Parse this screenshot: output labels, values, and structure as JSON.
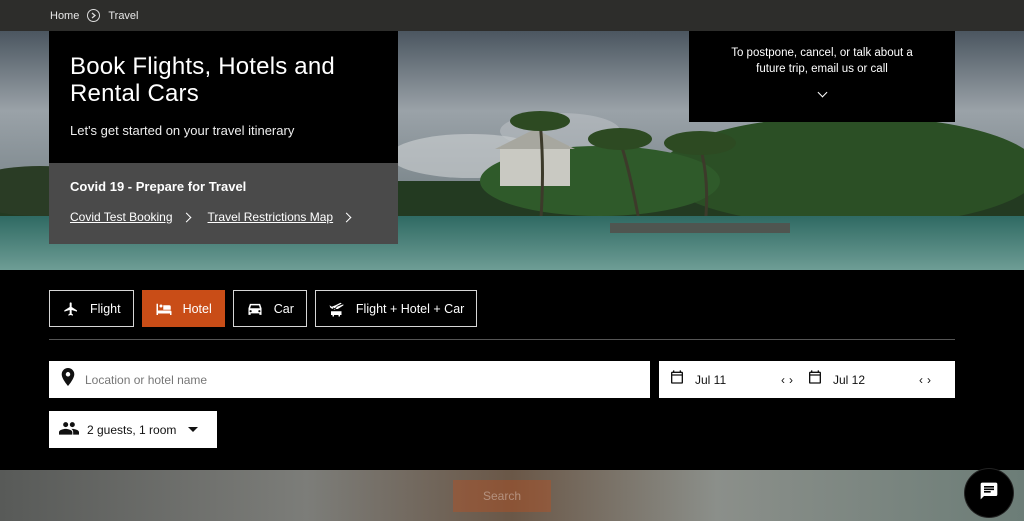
{
  "breadcrumb": {
    "home": "Home",
    "current": "Travel"
  },
  "hero": {
    "title_line1": "Book Flights, Hotels and",
    "title_line2": "Rental Cars",
    "subtitle": "Let's get started on your travel itinerary"
  },
  "covid": {
    "title": "Covid 19 - Prepare for Travel",
    "link1": "Covid Test Booking",
    "link2": "Travel Restrictions Map"
  },
  "contact": {
    "line1": "To postpone, cancel, or talk about a",
    "line2": "future trip, email us or call"
  },
  "tabs": [
    {
      "label": "Flight",
      "icon": "airplane-icon",
      "active": false
    },
    {
      "label": "Hotel",
      "icon": "bed-icon",
      "active": true
    },
    {
      "label": "Car",
      "icon": "car-icon",
      "active": false
    },
    {
      "label": "Flight + Hotel + Car",
      "icon": "flight-hotel-car-icon",
      "active": false
    }
  ],
  "search": {
    "location_placeholder": "Location or hotel name",
    "checkin": "Jul 11",
    "checkout": "Jul 12",
    "guests": "2 guests, 1 room",
    "button": "Search"
  },
  "colors": {
    "accent": "#c94d17",
    "panel": "#000000",
    "topbar": "#2d2d2b"
  }
}
